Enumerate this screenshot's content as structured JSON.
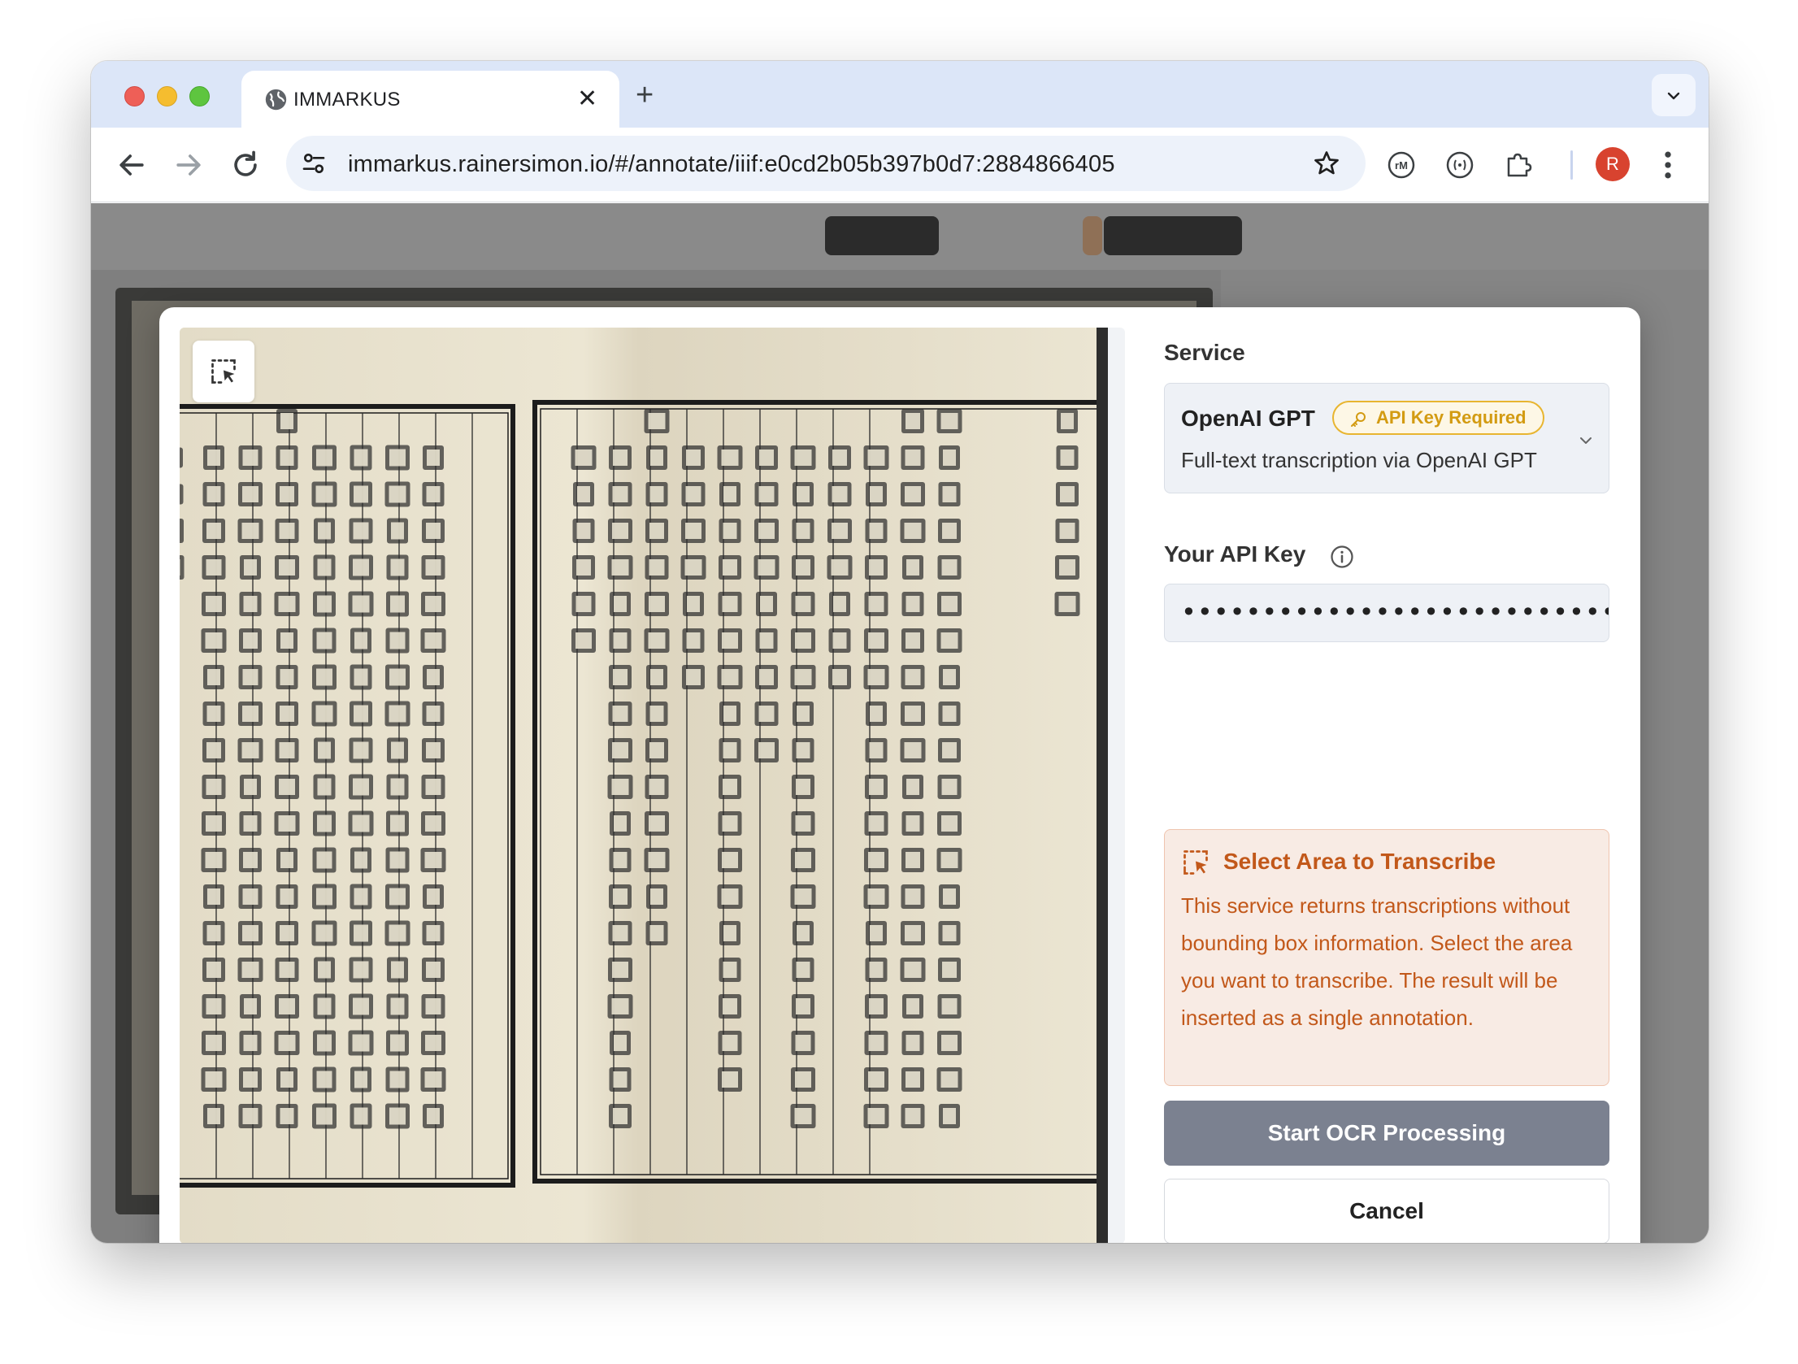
{
  "browser": {
    "tab_title": "IMMARKUS",
    "url": "immarkus.rainersimon.io/#/annotate/iiif:e0cd2b05b397b0d7:2884866405",
    "profile_initial": "R",
    "extension_1_label": "rM"
  },
  "modal": {
    "service_label": "Service",
    "service": {
      "name": "OpenAI GPT",
      "badge": "API Key Required",
      "description": "Full-text transcription via OpenAI GPT"
    },
    "api_key_label": "Your API Key",
    "api_key_value": "•••••••••••••••••••••••••••••••",
    "notice": {
      "title": "Select Area to Transcribe",
      "text": "This service returns transcriptions without bounding box information. Select the area you want to transcribe. The result will be inserted as a single annotation."
    },
    "start_button": "Start OCR Processing",
    "cancel_button": "Cancel"
  },
  "colors": {
    "accent_warning": "#c2581a",
    "badge_yellow": "#d39b12",
    "button_disabled": "#7b8190"
  },
  "icons": [
    "globe-icon",
    "close-icon",
    "plus-icon",
    "chevron-down-icon",
    "back-icon",
    "forward-icon",
    "reload-icon",
    "tune-icon",
    "star-icon",
    "extension-icon",
    "puzzle-icon",
    "kebab-icon",
    "select-area-icon",
    "key-icon",
    "info-icon"
  ]
}
